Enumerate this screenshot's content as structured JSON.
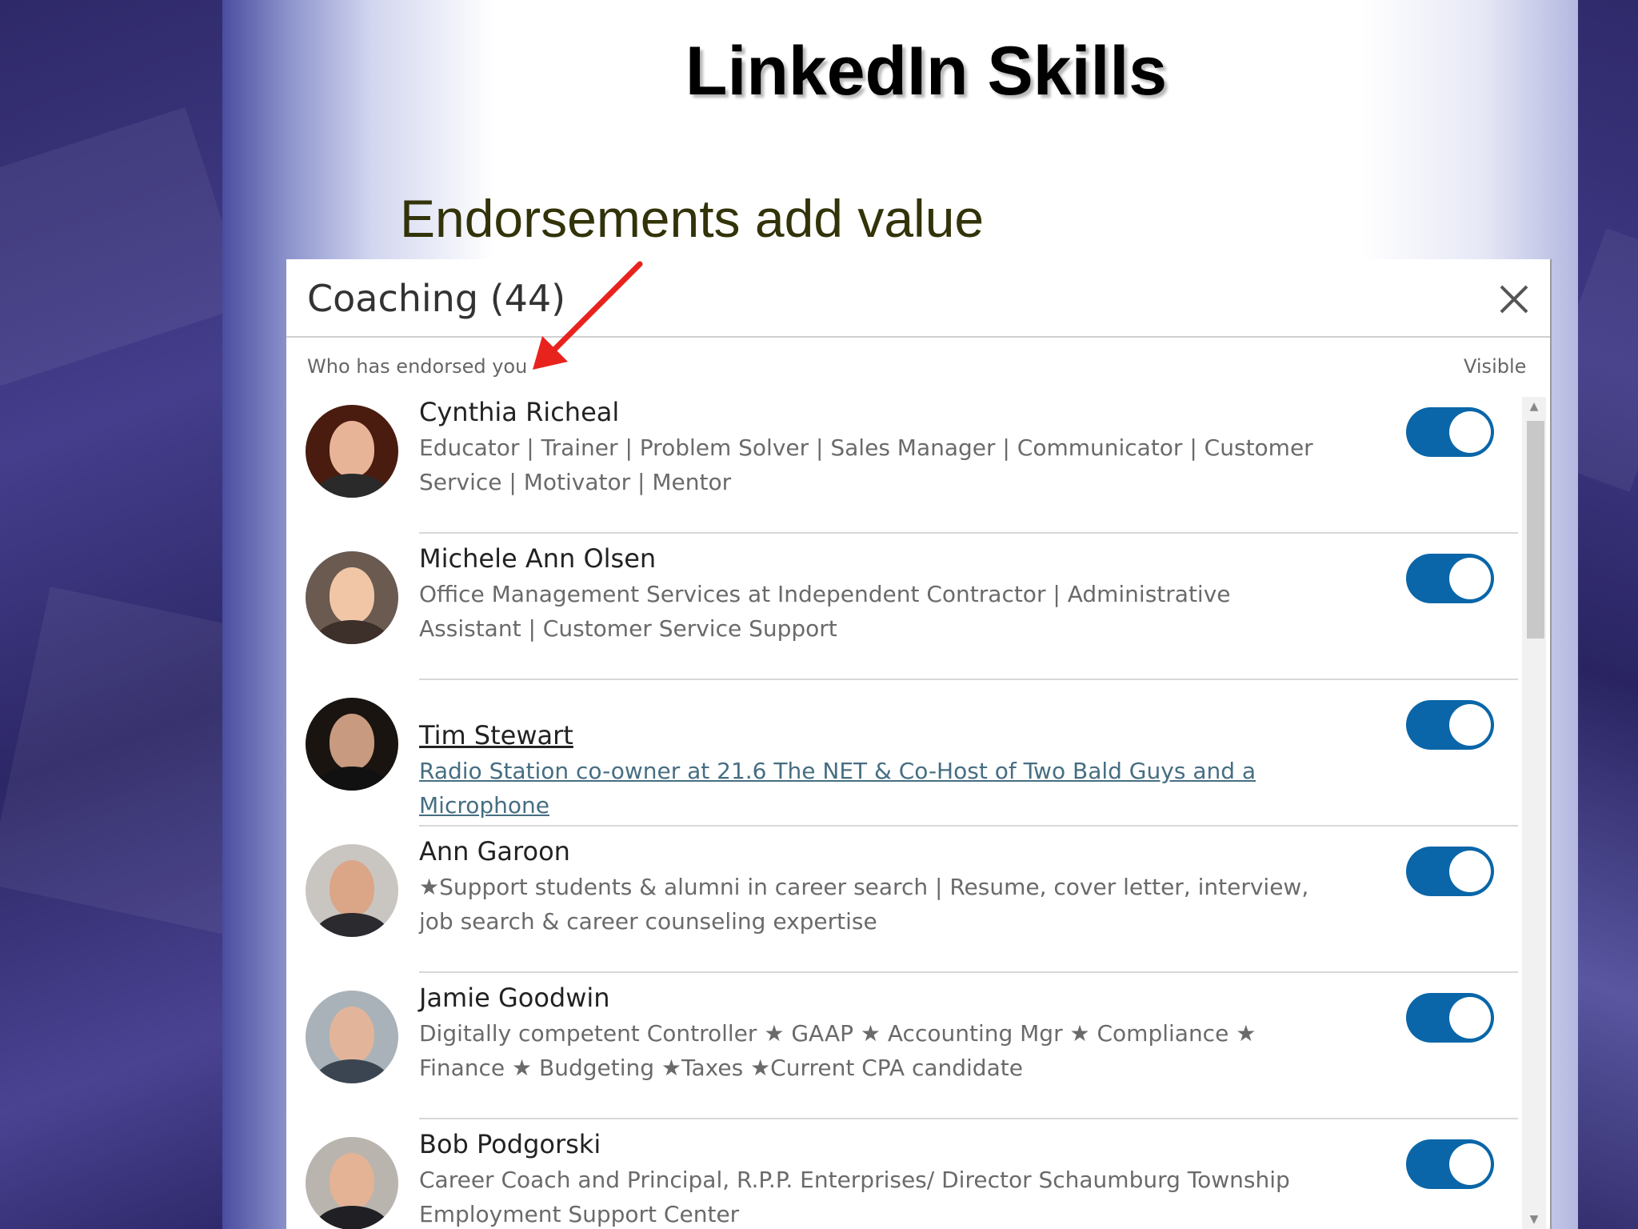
{
  "slide": {
    "title": "LinkedIn Skills",
    "subtitle": "Endorsements add value"
  },
  "dialog": {
    "title": "Coaching (44)",
    "close_icon": "close-icon",
    "col_left_label": "Who has endorsed you",
    "col_right_label": "Visible"
  },
  "endorsers": [
    {
      "name": "Cynthia Richeal",
      "headline": "Educator | Trainer | Problem Solver | Sales Manager | Communicator | Customer Service | Motivator | Mentor",
      "visible": true
    },
    {
      "name": "Michele Ann Olsen",
      "headline": "Office Management Services at Independent Contractor | Administrative Assistant | Customer Service Support",
      "visible": true
    },
    {
      "name": "Tim Stewart",
      "headline": "Radio Station co-owner at 21.6 The NET & Co-Host of Two Bald Guys and a Microphone",
      "visible": true
    },
    {
      "name": "Ann Garoon",
      "headline": "★Support students & alumni in career search | Resume, cover letter, interview, job search & career counseling expertise",
      "visible": true
    },
    {
      "name": "Jamie Goodwin",
      "headline": "Digitally competent Controller ★ GAAP ★ Accounting Mgr ★ Compliance ★ Finance ★ Budgeting ★Taxes ★Current CPA candidate",
      "visible": true
    },
    {
      "name": "Bob Podgorski",
      "headline": "Career Coach and Principal, R.P.P. Enterprises/ Director Schaumburg Township Employment Support Center",
      "visible": true
    }
  ],
  "colors": {
    "toggle_on": "#0a66a8",
    "arrow": "#e8231e",
    "slide_bg": "#3a3378"
  }
}
